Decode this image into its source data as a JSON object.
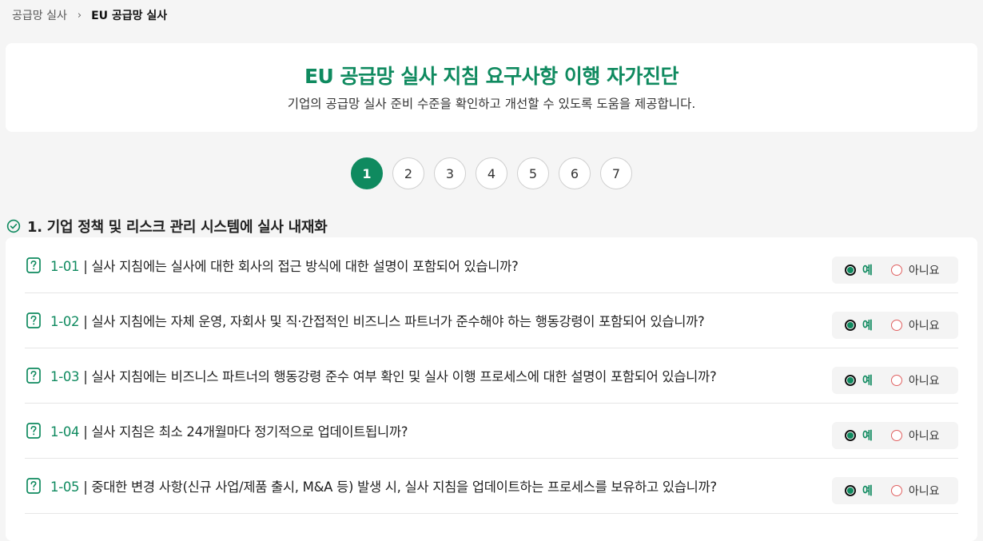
{
  "breadcrumb": {
    "parent": "공급망 실사",
    "separator": "›",
    "current": "EU 공급망 실사"
  },
  "hero": {
    "title": "EU 공급망 실사 지침 요구사항 이행 자가진단",
    "subtitle": "기업의 공급망 실사 준비 수준을 확인하고 개선할 수 있도록 도움을 제공합니다."
  },
  "steps": {
    "items": [
      "1",
      "2",
      "3",
      "4",
      "5",
      "6",
      "7"
    ],
    "active": "1"
  },
  "section": {
    "icon": "check-circle-icon",
    "title": "1. 기업 정책 및 리스크 관리 시스템에 실사 내재화"
  },
  "answer_labels": {
    "yes": "예",
    "no": "아니요"
  },
  "questions": [
    {
      "code": "1-01",
      "sep": " | ",
      "text": "실사 지침에는 실사에 대한 회사의 접근 방식에 대한 설명이 포함되어 있습니까?",
      "selected": "yes"
    },
    {
      "code": "1-02",
      "sep": " | ",
      "text": "실사 지침에는 자체 운영, 자회사 및 직·간접적인 비즈니스 파트너가 준수해야 하는 행동강령이 포함되어 있습니까?",
      "selected": "yes"
    },
    {
      "code": "1-03",
      "sep": " | ",
      "text": "실사 지침에는 비즈니스 파트너의 행동강령 준수 여부 확인 및 실사 이행 프로세스에 대한 설명이 포함되어 있습니까?",
      "selected": "yes"
    },
    {
      "code": "1-04",
      "sep": " | ",
      "text": "실사 지침은 최소 24개월마다 정기적으로 업데이트됩니까?",
      "selected": "yes"
    },
    {
      "code": "1-05",
      "sep": " | ",
      "text": "중대한 변경 사항(신규 사업/제품 출시, M&A 등) 발생 시, 실사 지침을 업데이트하는 프로세스를 보유하고 있습니까?",
      "selected": "yes"
    }
  ],
  "colors": {
    "accent": "#0f8a5f",
    "background": "#f5f5f5",
    "radio_off": "#e06060"
  }
}
